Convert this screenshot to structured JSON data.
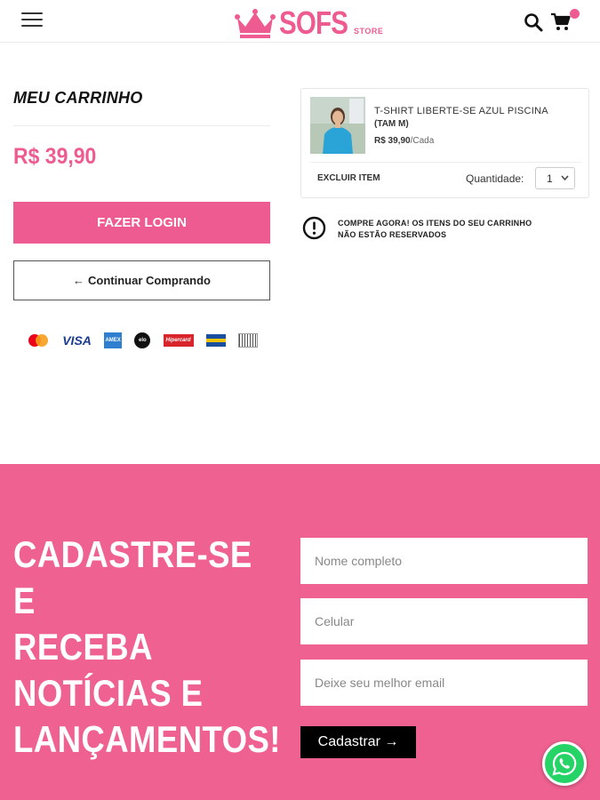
{
  "header": {
    "logo_text": "SOFS",
    "logo_sub": "STORE",
    "menu_icon": "hamburger-icon",
    "search_icon": "search-icon",
    "cart_icon": "cart-icon"
  },
  "cart": {
    "title": "MEU CARRINHO",
    "total": "R$ 39,90",
    "login_label": "FAZER LOGIN",
    "continue_arrow": "←",
    "continue_label": "Continuar Comprando",
    "payment_methods": [
      "Mastercard",
      "VISA",
      "American Express",
      "Elo",
      "Hipercard",
      "Diners",
      "Boleto"
    ],
    "payment_visa": "VISA",
    "payment_amex": "AMEX",
    "payment_elo": "elo",
    "payment_hiper": "Hipercard"
  },
  "item": {
    "name": "T-SHIRT LIBERTE-SE AZUL PISCINA",
    "size": "(TAM M)",
    "price": "R$ 39,90",
    "price_unit": "/Cada",
    "remove_label": "EXCLUIR ITEM",
    "quantity_label": "Quantidade:",
    "quantity_value": "1"
  },
  "warning": {
    "line1": "COMPRE AGORA! OS ITENS DO SEU CARRINHO",
    "line2": "NÃO ESTÃO RESERVADOS"
  },
  "newsletter": {
    "title_lines": [
      "CADASTRE-SE E",
      "RECEBA",
      "NOTÍCIAS E",
      "LANÇAMENTOS!"
    ],
    "name_placeholder": "Nome completo",
    "phone_placeholder": "Celular",
    "email_placeholder": "Deixe seu melhor email",
    "submit_label": "Cadastrar →"
  },
  "colors": {
    "brand_pink": "#ee5b90",
    "footer_pink": "#ee6190",
    "whatsapp_green": "#25d366"
  }
}
